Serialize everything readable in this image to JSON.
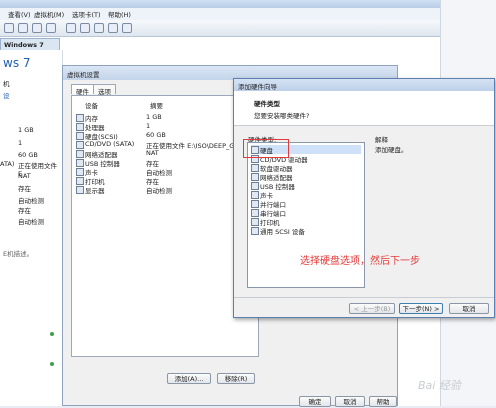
{
  "main": {
    "menu": [
      "查看(V)",
      "虚拟机(M)",
      "选项卡(T)",
      "帮助(H)"
    ],
    "vm_tab": "Windows 7",
    "vm_title_fragment": "ws 7",
    "left_fragments": [
      "机",
      "设"
    ],
    "left_labels": [
      "",
      "",
      "",
      "ATA)",
      "",
      "",
      "",
      ""
    ],
    "left_values": [
      "1 GB",
      "1",
      "60 GB",
      "正在使用文件 E",
      "NAT",
      "存在",
      "自动检测",
      "存在",
      "自动检测"
    ],
    "left_bottom": "E机描述。"
  },
  "vm_settings": {
    "title": "虚拟机设置",
    "tabs": [
      "硬件",
      "选项"
    ],
    "col_device": "设备",
    "col_summary": "摘要",
    "devices": [
      {
        "name": "内存",
        "summary": "1 GB"
      },
      {
        "name": "处理器",
        "summary": "1"
      },
      {
        "name": "硬盘(SCSI)",
        "summary": "60 GB"
      },
      {
        "name": "CD/DVD (SATA)",
        "summary": "正在使用文件 E:\\ISO\\DEEP_GH..."
      },
      {
        "name": "网络适配器",
        "summary": "NAT"
      },
      {
        "name": "USB 控制器",
        "summary": "存在"
      },
      {
        "name": "声卡",
        "summary": "自动检测"
      },
      {
        "name": "打印机",
        "summary": "存在"
      },
      {
        "name": "显示器",
        "summary": "自动检测"
      }
    ],
    "add_btn": "添加(A)...",
    "remove_btn": "移除(R)",
    "ok_btn": "确定",
    "cancel_btn": "取消",
    "help_btn": "帮助"
  },
  "wizard": {
    "title": "添加硬件向导",
    "heading": "硬件类型",
    "subheading": "您要安装哪类硬件?",
    "list_label": "硬件类型:",
    "desc_label": "解释",
    "desc_text": "添加硬盘。",
    "items": [
      "硬盘",
      "CD/DVD 驱动器",
      "软盘驱动器",
      "网络适配器",
      "USB 控制器",
      "声卡",
      "并行端口",
      "串行端口",
      "打印机",
      "通用 SCSI 设备"
    ],
    "back_btn": "< 上一步(B)",
    "next_btn": "下一步(N) >",
    "cancel_btn": "取消"
  },
  "annotation": "选择硬盘选项，然后下一步",
  "watermark": "Bai 经验"
}
